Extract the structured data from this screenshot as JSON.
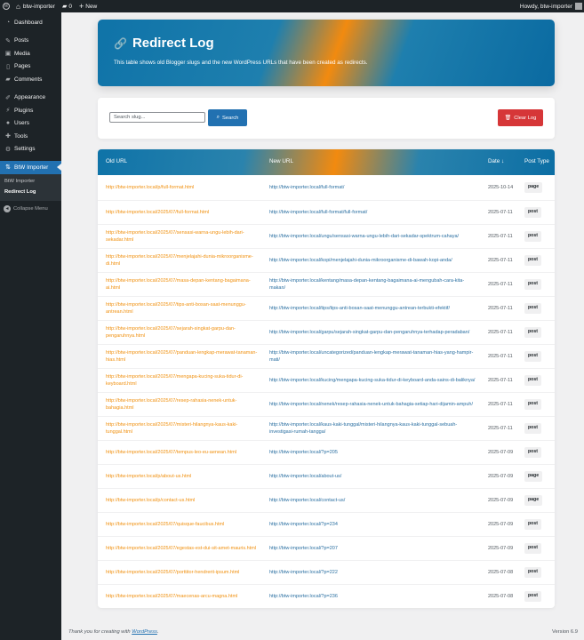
{
  "adminbar": {
    "site_name": "btw-importer",
    "comments_count": "0",
    "new_label": "New",
    "howdy": "Howdy, btw-importer"
  },
  "sidebar": {
    "items": [
      {
        "label": "Dashboard",
        "icon": "dashboard-icon"
      },
      {
        "label": "Posts",
        "icon": "pin-icon"
      },
      {
        "label": "Media",
        "icon": "media-icon"
      },
      {
        "label": "Pages",
        "icon": "page-icon"
      },
      {
        "label": "Comments",
        "icon": "comment-icon"
      },
      {
        "label": "Appearance",
        "icon": "brush-icon"
      },
      {
        "label": "Plugins",
        "icon": "plugin-icon"
      },
      {
        "label": "Users",
        "icon": "user-icon"
      },
      {
        "label": "Tools",
        "icon": "wrench-icon"
      },
      {
        "label": "Settings",
        "icon": "settings-icon"
      },
      {
        "label": "BtW Importer",
        "icon": "importer-icon"
      }
    ],
    "submenu": [
      "BtW Importer",
      "Redirect Log"
    ],
    "collapse_label": "Collapse Menu"
  },
  "header": {
    "title": "Redirect Log",
    "description": "This table shows old Blogger slugs and the new WordPress URLs that have been created as redirects."
  },
  "search": {
    "placeholder": "Search slug...",
    "search_label": "Search",
    "clear_label": "Clear Log"
  },
  "table": {
    "columns": {
      "old": "Old URL",
      "new": "New URL",
      "date": "Date ↓",
      "type": "Post Type"
    },
    "rows": [
      {
        "old": "http://btw-importer.local/p/full-format.html",
        "new": "http://btw-importer.local/full-format/",
        "date": "2025-10-14",
        "type": "page",
        "h": 29
      },
      {
        "old": "http://btw-importer.local/2025/07/full-format.html",
        "new": "http://btw-importer.local/full-format/full-format/",
        "date": "2025-07-11",
        "type": "post",
        "h": 27
      },
      {
        "old": "http://btw-importer.local/2025/07/sensasi-warna-ungu-lebih-dari-sekadar.html",
        "new": "http://btw-importer.local/ungu/sensasi-warna-ungu-lebih-dari-sekadar-spektrum-cahaya/",
        "date": "2025-07-11",
        "type": "post",
        "h": 27
      },
      {
        "old": "http://btw-importer.local/2025/07/menjelajahi-dunia-mikroorganisme-di.html",
        "new": "http://btw-importer.local/kopi/menjelajahi-dunia-mikroorganisme-di-bawah-kopi-anda/",
        "date": "2025-07-11",
        "type": "post",
        "h": 27
      },
      {
        "old": "http://btw-importer.local/2025/07/masa-depan-kentang-bagaimana-ai.html",
        "new": "http://btw-importer.local/kentang/masa-depan-kentang-bagaimana-ai-mengubah-cara-kita-makan/",
        "date": "2025-07-11",
        "type": "post",
        "h": 27
      },
      {
        "old": "http://btw-importer.local/2025/07/tips-anti-bosan-saat-menunggu-antrean.html",
        "new": "http://btw-importer.local/tips/tips-anti-bosan-saat-menunggu-antrean-terbukti-efektif/",
        "date": "2025-07-11",
        "type": "post",
        "h": 27
      },
      {
        "old": "http://btw-importer.local/2025/07/sejarah-singkat-garpu-dan-pengaruhnya.html",
        "new": "http://btw-importer.local/garpu/sejarah-singkat-garpu-dan-pengaruhnya-terhadap-peradaban/",
        "date": "2025-07-11",
        "type": "post",
        "h": 27
      },
      {
        "old": "http://btw-importer.local/2025/07/panduan-lengkap-merawat-tanaman-hias.html",
        "new": "http://btw-importer.local/uncategorized/panduan-lengkap-merawat-tanaman-hias-yang-hampir-mati/",
        "date": "2025-07-11",
        "type": "post",
        "h": 27
      },
      {
        "old": "http://btw-importer.local/2025/07/mengapa-kucing-suka-tidur-di-keyboard.html",
        "new": "http://btw-importer.local/kucing/mengapa-kucing-suka-tidur-di-keyboard-anda-sains-di-baliknya/",
        "date": "2025-07-11",
        "type": "post",
        "h": 27
      },
      {
        "old": "http://btw-importer.local/2025/07/resep-rahasia-nenek-untuk-bahagia.html",
        "new": "http://btw-importer.local/nenek/resep-rahasia-nenek-untuk-bahagia-setiap-hari-dijamin-ampuh/",
        "date": "2025-07-11",
        "type": "post",
        "h": 27
      },
      {
        "old": "http://btw-importer.local/2025/07/misteri-hilangnya-kaus-kaki-tunggal.html",
        "new": "http://btw-importer.local/kaus-kaki-tunggal/misteri-hilangnya-kaus-kaki-tunggal-sebuah-investigasi-rumah-tangga/",
        "date": "2025-07-11",
        "type": "post",
        "h": 27
      },
      {
        "old": "http://btw-importer.local/2025/07/tempus-leo-eu-aenean.html",
        "new": "http://btw-importer.local/?p=205",
        "date": "2025-07-09",
        "type": "post",
        "h": 27
      },
      {
        "old": "http://btw-importer.local/p/about-us.html",
        "new": "http://btw-importer.local/about-us/",
        "date": "2025-07-09",
        "type": "page",
        "h": 27
      },
      {
        "old": "http://btw-importer.local/p/contact-us.html",
        "new": "http://btw-importer.local/contact-us/",
        "date": "2025-07-09",
        "type": "page",
        "h": 27
      },
      {
        "old": "http://btw-importer.local/2025/07/quisque-faucibus.html",
        "new": "http://btw-importer.local/?p=234",
        "date": "2025-07-09",
        "type": "post",
        "h": 27
      },
      {
        "old": "http://btw-importer.local/2025/07/egestas-est-dui-sit-amet-mauris.html",
        "new": "http://btw-importer.local/?p=207",
        "date": "2025-07-09",
        "type": "post",
        "h": 27
      },
      {
        "old": "http://btw-importer.local/2025/07/porttitor-hendrerit-ipsum.html",
        "new": "http://btw-importer.local/?p=222",
        "date": "2025-07-08",
        "type": "post",
        "h": 27
      },
      {
        "old": "http://btw-importer.local/2025/07/maecenas-arcu-magna.html",
        "new": "http://btw-importer.local/?p=236",
        "date": "2025-07-08",
        "type": "post",
        "h": 27
      }
    ]
  },
  "footer": {
    "thanks_prefix": "Thank you for creating with ",
    "thanks_link": "WordPress",
    "thanks_suffix": ".",
    "version": "Version 6.9"
  }
}
